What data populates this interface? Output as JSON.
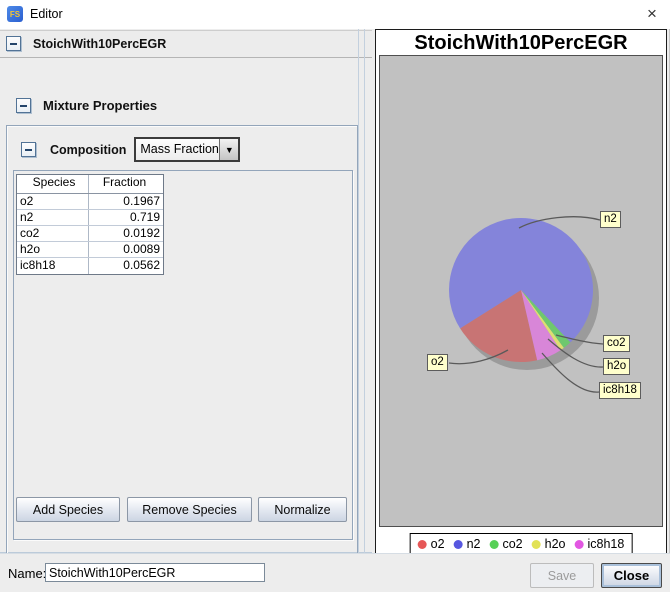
{
  "window": {
    "title": "Editor",
    "app_badge": "FS"
  },
  "icons": {
    "close": "×",
    "collapse": "−",
    "combo_arrow": "▼"
  },
  "left_panel": {
    "section_title": "StoichWith10PercEGR",
    "subsection_title": "Mixture Properties",
    "composition": {
      "label": "Composition",
      "combo_value": "Mass Fraction"
    },
    "table": {
      "columns": [
        "Species",
        "Fraction"
      ],
      "rows": [
        [
          "o2",
          "0.1967"
        ],
        [
          "n2",
          "0.719"
        ],
        [
          "co2",
          "0.0192"
        ],
        [
          "h2o",
          "0.0089"
        ],
        [
          "ic8h18",
          "0.0562"
        ]
      ]
    },
    "buttons": [
      {
        "label": "Add Species"
      },
      {
        "label": "Remove Species"
      },
      {
        "label": "Normalize"
      }
    ]
  },
  "chart_data": {
    "type": "pie",
    "title": "StoichWith10PercEGR",
    "categories": [
      "o2",
      "n2",
      "co2",
      "h2o",
      "ic8h18"
    ],
    "values": [
      0.1967,
      0.719,
      0.0192,
      0.0089,
      0.0562
    ],
    "colors_pie": [
      "#c87474",
      "#8484da",
      "#6ec86e",
      "#dede72",
      "#d886d8"
    ],
    "colors_legend": [
      "#e65757",
      "#5757e0",
      "#57d057",
      "#e2e257",
      "#e257e2"
    ],
    "start_angle_deg": 283,
    "direction": "clockwise",
    "legend_position": "bottom",
    "plot_background": "#c1c1c1",
    "label_background": "#ffffcc"
  },
  "footer": {
    "name_label": "Name:",
    "name_value": "StoichWith10PercEGR",
    "save_label": "Save",
    "save_enabled": false,
    "close_label": "Close"
  }
}
